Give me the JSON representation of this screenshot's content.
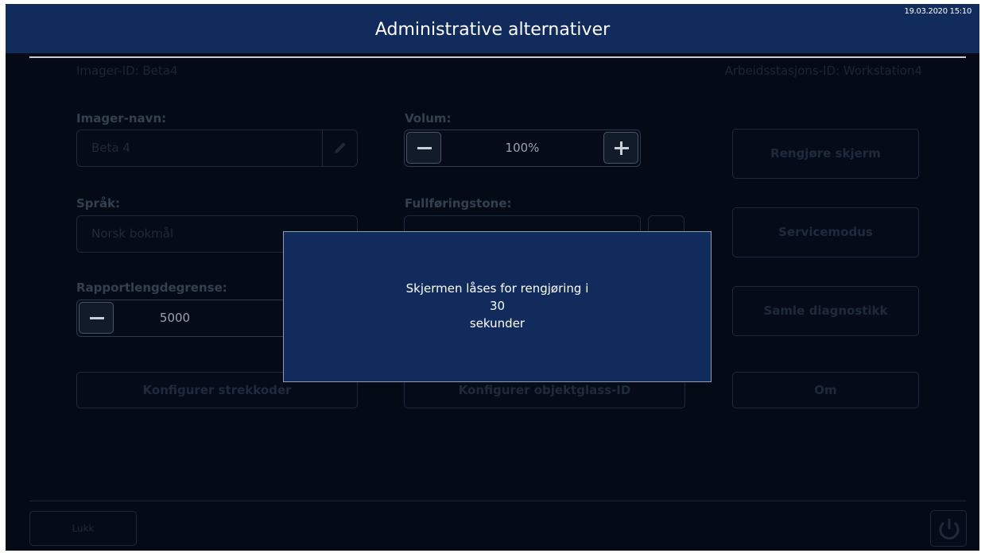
{
  "header": {
    "title": "Administrative alternativer",
    "datetime": "19.03.2020 15:10"
  },
  "info": {
    "imager_id": "Imager-ID: Beta4",
    "workstation_id": "Arbeidsstasjons-ID: Workstation4"
  },
  "imager_name": {
    "label": "Imager-navn:",
    "value": "Beta 4"
  },
  "language": {
    "label": "Språk:",
    "value": "Norsk bokmål"
  },
  "report_limit": {
    "label": "Rapportlengdegrense:",
    "value": "5000"
  },
  "volume": {
    "label": "Volum:",
    "value": "100%"
  },
  "completion_tone": {
    "label": "Fullføringstone:"
  },
  "buttons": {
    "clean_screen": "Rengjøre skjerm",
    "service_mode": "Servicemodus",
    "collect_diagnostics": "Samle diagnostikk",
    "about": "Om",
    "configure_barcodes": "Konfigurer strekkoder",
    "configure_slide_id": "Konfigurer objektglass-ID",
    "close": "Lukk"
  },
  "modal": {
    "line1": "Skjermen låses for rengjøring i",
    "seconds": "30",
    "line3": "sekunder"
  },
  "icons": {
    "edit": "pencil-icon",
    "decrement": "minus-icon",
    "increment": "plus-icon",
    "sound": "speaker-icon",
    "power": "power-icon"
  }
}
